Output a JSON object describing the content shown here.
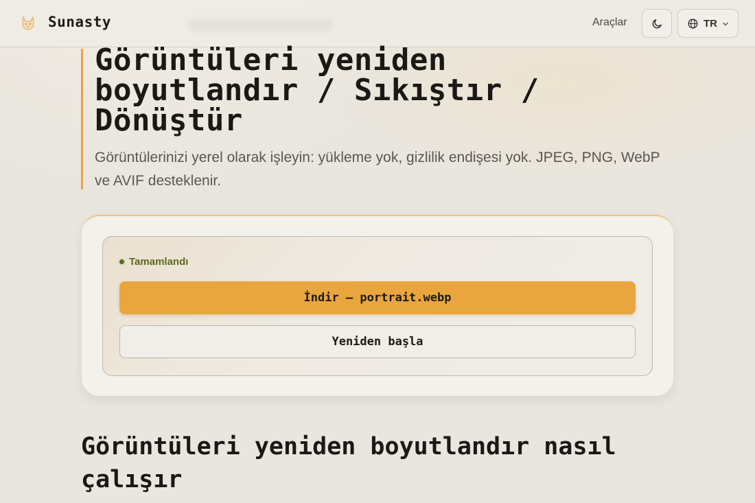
{
  "header": {
    "brand": "Sunasty",
    "logo_icon": "cat-logo-icon",
    "nav_tools": "Araçlar",
    "theme_icon": "moon-icon",
    "language_icon": "globe-icon",
    "language": "TR",
    "language_chevron_icon": "chevron-down-icon"
  },
  "hero": {
    "title": "Görüntüleri yeniden boyutlandır / Sıkıştır / Dönüştür",
    "subtitle": "Görüntülerinizi yerel olarak işleyin: yükleme yok, gizlilik endişesi yok. JPEG, PNG, WebP ve AVIF desteklenir."
  },
  "result": {
    "status": "Tamamlandı",
    "download_label": "İndir — portrait.webp",
    "restart_label": "Yeniden başla"
  },
  "section": {
    "title": "Görüntüleri yeniden boyutlandır nasıl çalışır"
  },
  "colors": {
    "accent": "#e9a63f",
    "success": "#5b6a1c",
    "background": "#e9e6e0"
  }
}
